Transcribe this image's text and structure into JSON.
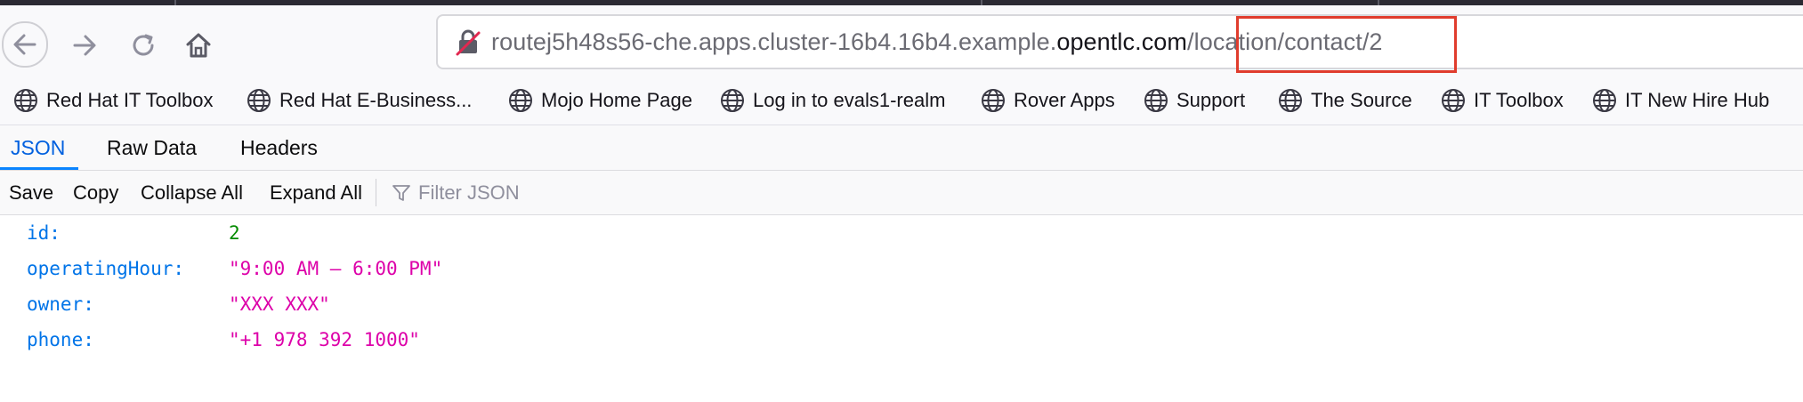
{
  "browser": {
    "url": {
      "prefix": "routej5h48s56-che.apps.cluster-16b4.16b4.example.",
      "domain": "opentlc.com",
      "path": "/location/contact/2"
    },
    "nav_icons": [
      "back-icon",
      "forward-icon",
      "reload-icon",
      "home-icon"
    ],
    "highlight_color": "#e03c2d"
  },
  "bookmarks": [
    {
      "label": "Red Hat IT Toolbox",
      "icon": "globe-icon"
    },
    {
      "label": "Red Hat E-Business...",
      "icon": "globe-icon"
    },
    {
      "label": "Mojo Home Page",
      "icon": "globe-icon"
    },
    {
      "label": "Log in to evals1-realm",
      "icon": "globe-icon"
    },
    {
      "label": "Rover Apps",
      "icon": "globe-icon"
    },
    {
      "label": "Support",
      "icon": "globe-icon"
    },
    {
      "label": "The Source",
      "icon": "globe-icon"
    },
    {
      "label": "IT Toolbox",
      "icon": "globe-icon"
    },
    {
      "label": "IT New Hire Hub",
      "icon": "globe-icon"
    }
  ],
  "viewer": {
    "tabs": [
      {
        "label": "JSON",
        "active": true
      },
      {
        "label": "Raw Data",
        "active": false
      },
      {
        "label": "Headers",
        "active": false
      }
    ],
    "toolbar": {
      "save": "Save",
      "copy": "Copy",
      "collapse_all": "Collapse All",
      "expand_all": "Expand All",
      "filter_placeholder": "Filter JSON"
    },
    "rows": [
      {
        "key": "id:",
        "value": "2",
        "type": "number"
      },
      {
        "key": "operatingHour:",
        "value": "\"9:00 AM – 6:00 PM\"",
        "type": "string"
      },
      {
        "key": "owner:",
        "value": "\"XXX XXX\"",
        "type": "string"
      },
      {
        "key": "phone:",
        "value": "\"+1 978 392 1000\"",
        "type": "string"
      }
    ],
    "colors": {
      "key": "#0074e8",
      "number": "#058b00",
      "string": "#dd00a9",
      "active_tab": "#0060df"
    }
  }
}
